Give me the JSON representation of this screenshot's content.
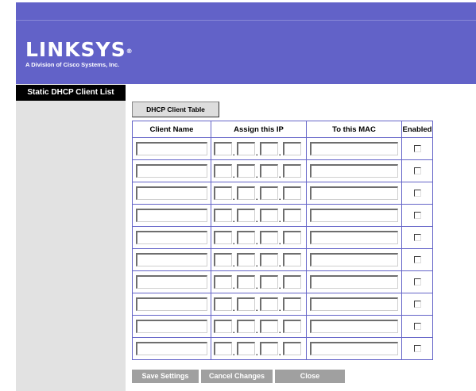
{
  "brand": {
    "logo_text": "LINKSYS",
    "logo_mark": "®",
    "tagline": "A Division of Cisco Systems, Inc."
  },
  "sidebar": {
    "title": "Static DHCP Client List"
  },
  "toolbar": {
    "dhcp_client_table_label": "DHCP Client Table"
  },
  "table": {
    "headers": [
      "Client Name",
      "Assign this IP",
      "To this MAC",
      "Enabled"
    ],
    "ip_separator": ".",
    "rows": [
      {
        "client_name": "",
        "ip": [
          "",
          "",
          "",
          ""
        ],
        "mac": "",
        "enabled": false
      },
      {
        "client_name": "",
        "ip": [
          "",
          "",
          "",
          ""
        ],
        "mac": "",
        "enabled": false
      },
      {
        "client_name": "",
        "ip": [
          "",
          "",
          "",
          ""
        ],
        "mac": "",
        "enabled": false
      },
      {
        "client_name": "",
        "ip": [
          "",
          "",
          "",
          ""
        ],
        "mac": "",
        "enabled": false
      },
      {
        "client_name": "",
        "ip": [
          "",
          "",
          "",
          ""
        ],
        "mac": "",
        "enabled": false
      },
      {
        "client_name": "",
        "ip": [
          "",
          "",
          "",
          ""
        ],
        "mac": "",
        "enabled": false
      },
      {
        "client_name": "",
        "ip": [
          "",
          "",
          "",
          ""
        ],
        "mac": "",
        "enabled": false
      },
      {
        "client_name": "",
        "ip": [
          "",
          "",
          "",
          ""
        ],
        "mac": "",
        "enabled": false
      },
      {
        "client_name": "",
        "ip": [
          "",
          "",
          "",
          ""
        ],
        "mac": "",
        "enabled": false
      },
      {
        "client_name": "",
        "ip": [
          "",
          "",
          "",
          ""
        ],
        "mac": "",
        "enabled": false
      }
    ]
  },
  "footer": {
    "save_label": "Save Settings",
    "cancel_label": "Cancel Changes",
    "close_label": "Close"
  },
  "colors": {
    "header_bg": "#6262c8",
    "sidebar_bg": "#e2e2e2",
    "table_border": "#6464c8",
    "footer_button_bg": "#a0a0a0"
  }
}
